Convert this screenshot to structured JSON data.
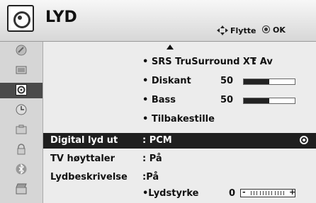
{
  "header": {
    "title": "LYD",
    "hint_move": "Flytte",
    "hint_ok": "OK",
    "icon": "speaker-icon"
  },
  "sidebar": {
    "items": [
      {
        "icon": "satellite-dish-icon"
      },
      {
        "icon": "picture-icon"
      },
      {
        "icon": "sound-icon",
        "active": true
      },
      {
        "icon": "clock-icon"
      },
      {
        "icon": "options-icon"
      },
      {
        "icon": "lock-icon"
      },
      {
        "icon": "bluetooth-icon"
      },
      {
        "icon": "media-clapper-icon"
      }
    ]
  },
  "menu": {
    "srs": {
      "label": "• SRS TruSurround XT",
      "value": ": Av"
    },
    "diskant": {
      "label": "• Diskant",
      "value": "50",
      "level": 0.5
    },
    "bass": {
      "label": "• Bass",
      "value": "50",
      "level": 0.5
    },
    "reset": {
      "label": "• Tilbakestille"
    },
    "digital_out": {
      "label": "Digital lyd ut",
      "value": ": PCM"
    },
    "tv_speaker": {
      "label": "TV høyttaler",
      "value": ": På"
    },
    "audio_desc": {
      "label": "Lydbeskrivelse",
      "value": ":På"
    },
    "volume": {
      "label": "•Lydstyrke",
      "value": "0",
      "minus": "-",
      "plus": "+"
    }
  },
  "colors": {
    "selected_bg": "#1f1f1f",
    "active_sidebar_bg": "#4a4a4a"
  }
}
